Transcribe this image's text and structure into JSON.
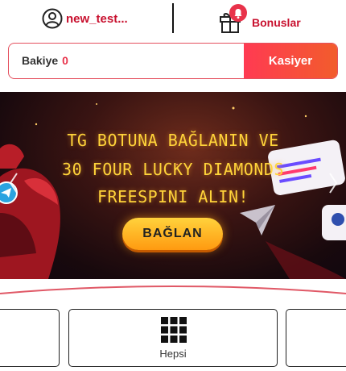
{
  "header": {
    "username": "new_test...",
    "bonus_label": "Bonuslar"
  },
  "balance": {
    "label": "Bakiye",
    "value": "0",
    "cashier_label": "Kasiyer"
  },
  "banner": {
    "line1": "TG BOTUNA BAĞLANIN VE",
    "line2": "30 FOUR LUCKY DIAMONDS",
    "line3": "FREESPINI ALIN!",
    "cta": "BAĞLAN"
  },
  "categories": {
    "items": [
      {
        "label": "",
        "icon": ""
      },
      {
        "label": "Hepsi",
        "icon": "grid-icon"
      },
      {
        "label": "",
        "icon": ""
      }
    ]
  },
  "colors": {
    "brand_red": "#c8102e",
    "cashier_gradient_start": "#ff3a52",
    "cashier_gradient_end": "#f25c2c",
    "banner_text": "#ffd43a",
    "cta_yellow": "#ffd23c"
  }
}
